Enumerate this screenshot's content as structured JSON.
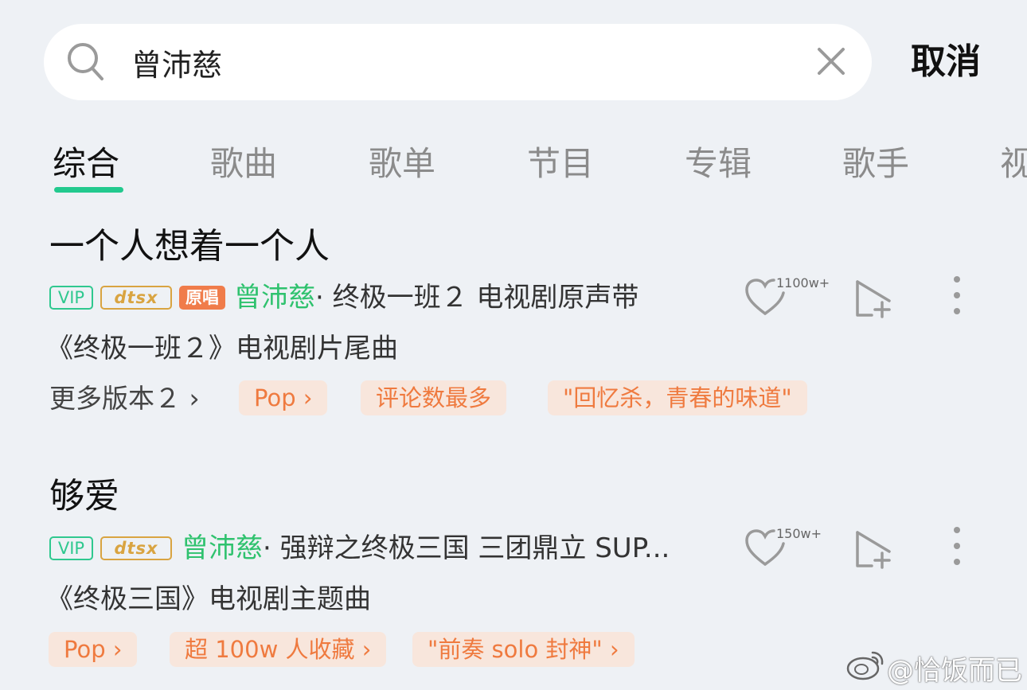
{
  "search": {
    "query": "曾沛慈",
    "cancel_label": "取消"
  },
  "tabs": [
    {
      "label": "综合",
      "active": true
    },
    {
      "label": "歌曲"
    },
    {
      "label": "歌单"
    },
    {
      "label": "节目"
    },
    {
      "label": "专辑"
    },
    {
      "label": "歌手"
    },
    {
      "label": "视"
    }
  ],
  "songs": [
    {
      "title": "一个人想着一个人",
      "badges": [
        "VIP",
        "dtsx",
        "原唱"
      ],
      "artist": "曾沛慈",
      "meta": "· 终极一班２ 电视剧原声带",
      "description": "《终极一班２》电视剧片尾曲",
      "more_versions": "更多版本２ ›",
      "tags": [
        "Pop ›",
        "评论数最多",
        "\"回忆杀，青春的味道\""
      ],
      "like_count": "1100w+"
    },
    {
      "title": "够爱",
      "badges": [
        "VIP",
        "dtsx"
      ],
      "artist": "曾沛慈",
      "meta": "· 强辩之终极三国 三团鼎立 SUP...",
      "description": "《终极三国》电视剧主题曲",
      "tags": [
        "Pop ›",
        "超 100w 人收藏 ›",
        "\"前奏 solo 封神\" ›"
      ],
      "like_count": "150w+"
    }
  ],
  "watermark": "@恰饭而已",
  "colors": {
    "accent_green": "#22c98e",
    "artist_green": "#2fc26e",
    "tag_orange": "#ef7a3f",
    "tag_bg": "#f8e6dc",
    "background": "#eef1f5"
  }
}
